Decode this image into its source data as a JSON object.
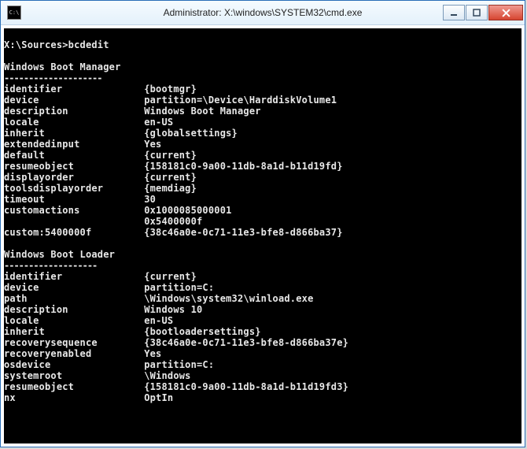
{
  "window": {
    "title": "Administrator: X:\\windows\\SYSTEM32\\cmd.exe",
    "icon_label": "C:\\"
  },
  "prompt": {
    "path": "X:\\Sources>",
    "command": "bcdedit"
  },
  "sections": {
    "manager": {
      "title": "Windows Boot Manager",
      "underline": "--------------------",
      "rows": [
        {
          "key": "identifier",
          "value": "{bootmgr}"
        },
        {
          "key": "device",
          "value": "partition=\\Device\\HarddiskVolume1"
        },
        {
          "key": "description",
          "value": "Windows Boot Manager"
        },
        {
          "key": "locale",
          "value": "en-US"
        },
        {
          "key": "inherit",
          "value": "{globalsettings}"
        },
        {
          "key": "extendedinput",
          "value": "Yes"
        },
        {
          "key": "default",
          "value": "{current}"
        },
        {
          "key": "resumeobject",
          "value": "{158181c0-9a00-11db-8a1d-b11d19fd}"
        },
        {
          "key": "displayorder",
          "value": "{current}"
        },
        {
          "key": "toolsdisplayorder",
          "value": "{memdiag}"
        },
        {
          "key": "timeout",
          "value": "30"
        },
        {
          "key": "customactions",
          "value": "0x1000085000001"
        },
        {
          "key": "",
          "value": "0x5400000f"
        },
        {
          "key": "custom:5400000f",
          "value": "{38c46a0e-0c71-11e3-bfe8-d866ba37}"
        }
      ]
    },
    "loader": {
      "title": "Windows Boot Loader",
      "underline": "-------------------",
      "rows": [
        {
          "key": "identifier",
          "value": "{current}"
        },
        {
          "key": "device",
          "value": "partition=C:"
        },
        {
          "key": "path",
          "value": "\\Windows\\system32\\winload.exe"
        },
        {
          "key": "description",
          "value": "Windows 10"
        },
        {
          "key": "locale",
          "value": "en-US"
        },
        {
          "key": "inherit",
          "value": "{bootloadersettings}"
        },
        {
          "key": "recoverysequence",
          "value": "{38c46a0e-0c71-11e3-bfe8-d866ba37e}"
        },
        {
          "key": "recoveryenabled",
          "value": "Yes"
        },
        {
          "key": "osdevice",
          "value": "partition=C:"
        },
        {
          "key": "systemroot",
          "value": "\\Windows"
        },
        {
          "key": "resumeobject",
          "value": "{158181c0-9a00-11db-8a1d-b11d19fd3}"
        },
        {
          "key": "nx",
          "value": "OptIn"
        }
      ]
    }
  }
}
